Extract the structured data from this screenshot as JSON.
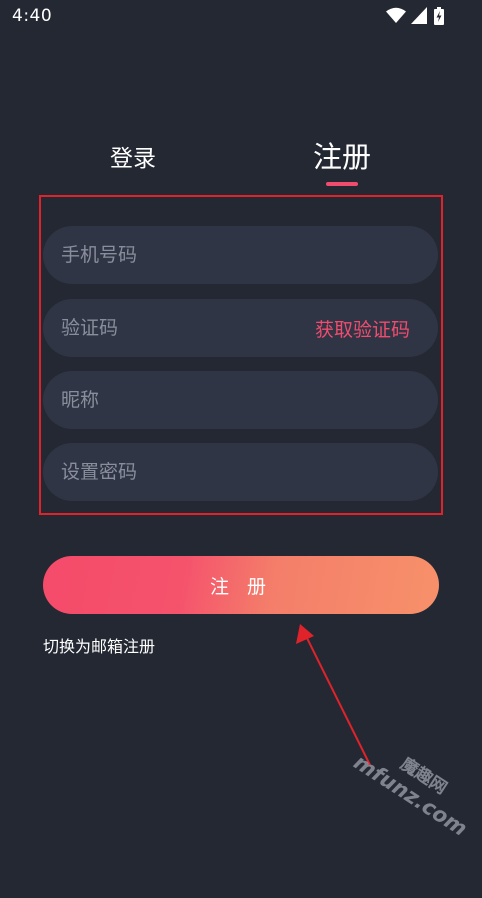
{
  "status_bar": {
    "time": "4:40",
    "icons": [
      "wifi-icon",
      "cell-signal-icon",
      "battery-charging-icon"
    ]
  },
  "tabs": [
    {
      "label": "登录",
      "active": false
    },
    {
      "label": "注册",
      "active": true
    }
  ],
  "form": {
    "phone": {
      "placeholder": "手机号码",
      "value": ""
    },
    "code": {
      "placeholder": "验证码",
      "value": "",
      "action_label": "获取验证码"
    },
    "nickname": {
      "placeholder": "昵称",
      "value": ""
    },
    "password": {
      "placeholder": "设置密码",
      "value": ""
    }
  },
  "actions": {
    "register_label": "注 册",
    "switch_email_label": "切换为邮箱注册"
  },
  "watermark": {
    "cn": "魔趣网",
    "en": "mfunz.com"
  },
  "colors": {
    "background": "#242833",
    "field": "#2f3545",
    "accent": "#f04c6e",
    "gradient_start": "#f44b6a",
    "gradient_end": "#f7916a",
    "annotation": "#e0232b"
  }
}
